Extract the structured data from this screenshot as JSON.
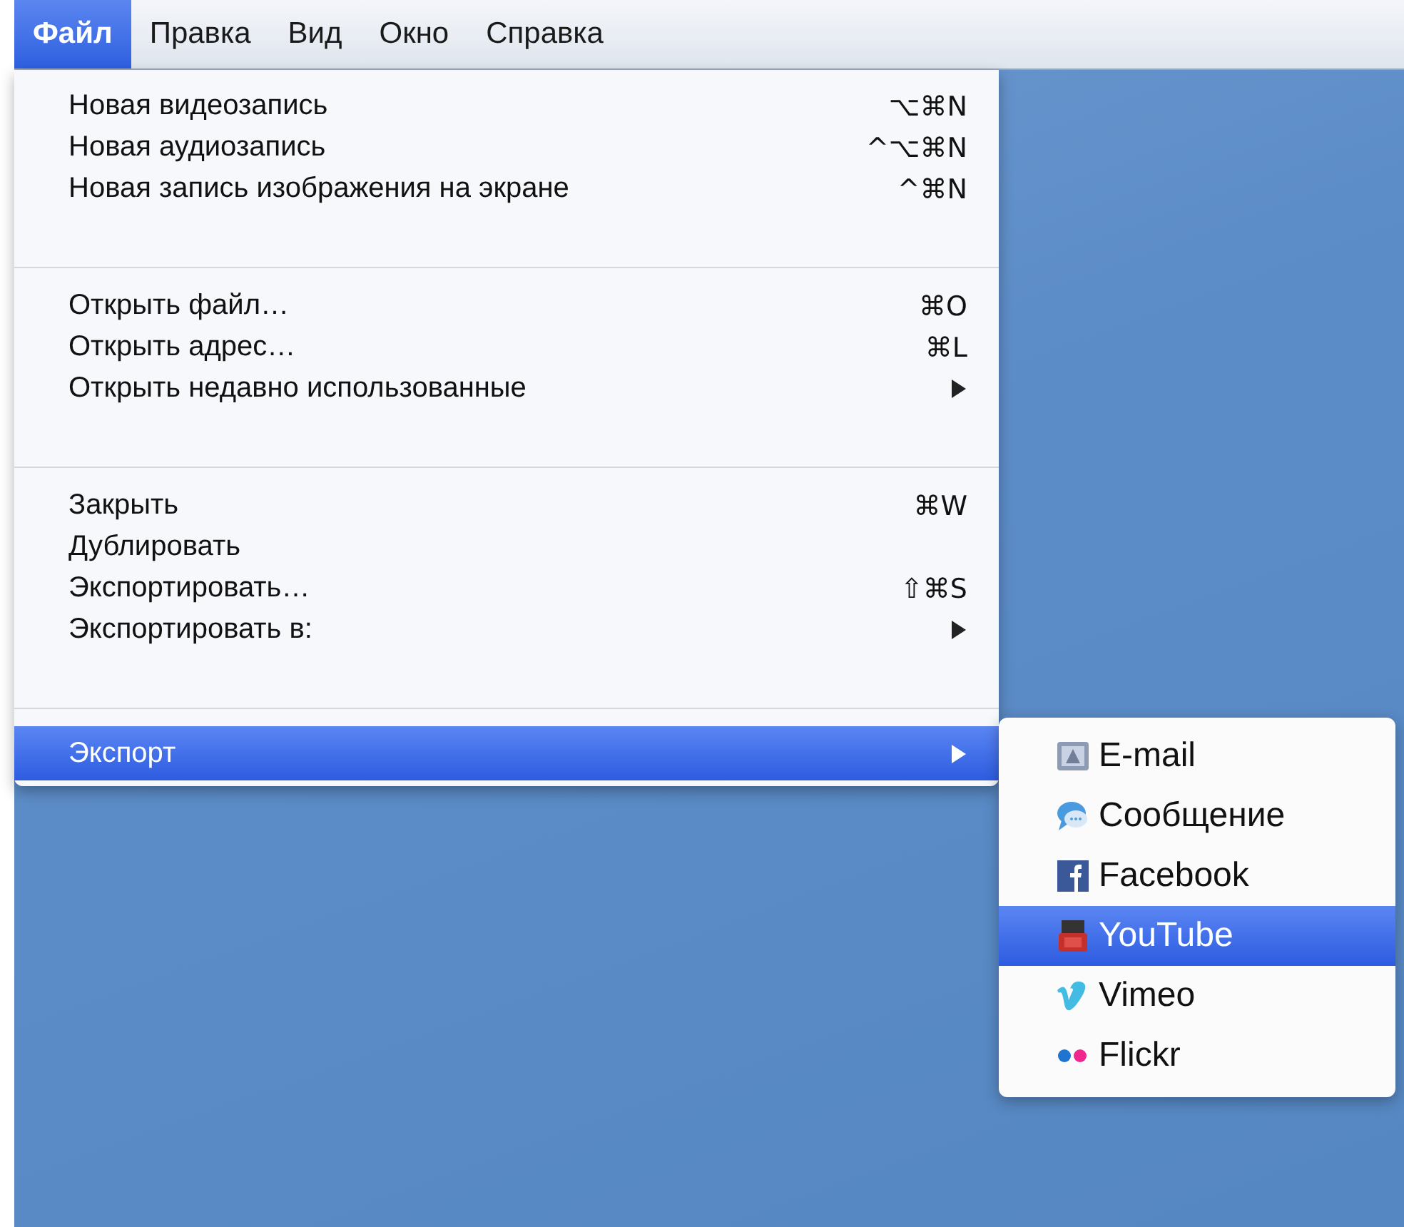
{
  "menubar": [
    {
      "label": "Файл",
      "selected": true
    },
    {
      "label": "Правка",
      "selected": false
    },
    {
      "label": "Вид",
      "selected": false
    },
    {
      "label": "Окно",
      "selected": false
    },
    {
      "label": "Справка",
      "selected": false
    }
  ],
  "menu": {
    "groups": [
      [
        {
          "label": "Новая видеозапись",
          "shortcut": "⌥⌘N",
          "submenu": false,
          "selected": false
        },
        {
          "label": "Новая аудиозапись",
          "shortcut": "^⌥⌘N",
          "submenu": false,
          "selected": false
        },
        {
          "label": "Новая запись изображения на экране",
          "shortcut": "^⌘N",
          "submenu": false,
          "selected": false
        }
      ],
      [
        {
          "label": "Открыть файл…",
          "shortcut": "⌘O",
          "submenu": false,
          "selected": false
        },
        {
          "label": "Открыть адрес…",
          "shortcut": "⌘L",
          "submenu": false,
          "selected": false
        },
        {
          "label": "Открыть недавно использованные",
          "submenu": true,
          "selected": false
        }
      ],
      [
        {
          "label": "Закрыть",
          "shortcut": "⌘W",
          "submenu": false,
          "selected": false
        },
        {
          "label": "Дублировать",
          "submenu": false,
          "selected": false
        },
        {
          "label": "Экспортировать…",
          "shortcut": "⇧⌘S",
          "submenu": false,
          "selected": false
        },
        {
          "label": "Экспортировать в:",
          "submenu": true,
          "selected": false
        }
      ],
      [
        {
          "label": "Экспорт",
          "submenu": true,
          "selected": true
        }
      ]
    ]
  },
  "submenu": {
    "items": [
      {
        "kind": "mail",
        "label": "E-mail",
        "selected": false
      },
      {
        "kind": "message",
        "label": "Сообщение",
        "selected": false
      },
      {
        "kind": "facebook",
        "label": "Facebook",
        "selected": false
      },
      {
        "kind": "youtube",
        "label": "YouTube",
        "selected": true
      },
      {
        "kind": "vimeo",
        "label": "Vimeo",
        "selected": false
      },
      {
        "kind": "flickr",
        "label": "Flickr",
        "selected": false
      }
    ]
  }
}
